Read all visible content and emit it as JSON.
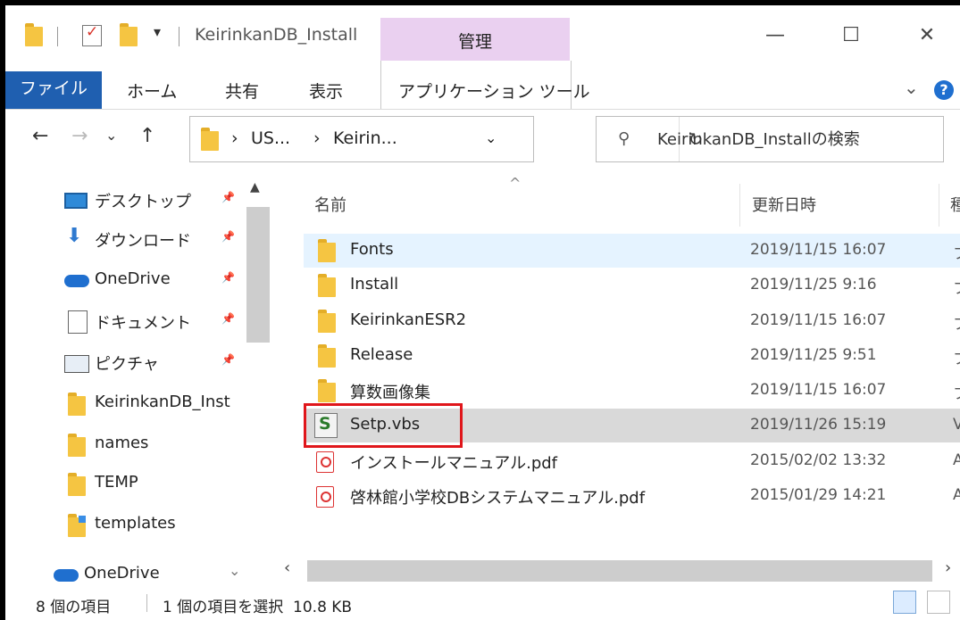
{
  "titlebar": {
    "title": "KeirinkanDB_Install",
    "context_tab": "管理",
    "minimize": "—",
    "maximize": "☐",
    "close": "✕",
    "qat_dropdown": "▾"
  },
  "ribbon": {
    "tabs": [
      "ファイル",
      "ホーム",
      "共有",
      "表示",
      "アプリケーション ツール"
    ],
    "expand": "⌄",
    "help": "?"
  },
  "address": {
    "crumbs": [
      "US...",
      "Keirin..."
    ],
    "chevron": "›",
    "dropdown": "⌄",
    "refresh": "↻",
    "nav_back": "←",
    "nav_forward": "→",
    "nav_recent": "⌄",
    "nav_up": "↑"
  },
  "search": {
    "placeholder": "KeirinkanDB_Installの検索"
  },
  "navpane": {
    "items": [
      {
        "label": "デスクトップ",
        "icon": "desktop-icon",
        "pinned": true
      },
      {
        "label": "ダウンロード",
        "icon": "download-icon",
        "pinned": true
      },
      {
        "label": "OneDrive",
        "icon": "cloud-icon",
        "pinned": true
      },
      {
        "label": "ドキュメント",
        "icon": "documents-icon",
        "pinned": true
      },
      {
        "label": "ピクチャ",
        "icon": "pictures-icon",
        "pinned": true
      },
      {
        "label": "KeirinkanDB_Inst",
        "icon": "folder-icon",
        "pinned": false
      },
      {
        "label": "names",
        "icon": "folder-icon",
        "pinned": false
      },
      {
        "label": "TEMP",
        "icon": "folder-icon",
        "pinned": false
      },
      {
        "label": "templates",
        "icon": "folder-shortcut-icon",
        "pinned": false
      },
      {
        "label": "OneDrive",
        "icon": "cloud-icon",
        "pinned": false
      }
    ],
    "pin_glyph": "📌",
    "collapse": "⌄"
  },
  "columns": {
    "name": "名前",
    "modified": "更新日時",
    "type": "種",
    "sort_caret": "^"
  },
  "files": [
    {
      "name": "Fonts",
      "date": "2019/11/15 16:07",
      "type": "フ",
      "icon": "folder-icon"
    },
    {
      "name": "Install",
      "date": "2019/11/25 9:16",
      "type": "フ",
      "icon": "folder-icon"
    },
    {
      "name": "KeirinkanESR2",
      "date": "2019/11/15 16:07",
      "type": "フ",
      "icon": "folder-icon"
    },
    {
      "name": "Release",
      "date": "2019/11/25 9:51",
      "type": "フ",
      "icon": "folder-icon"
    },
    {
      "name": "算数画像集",
      "date": "2019/11/15 16:07",
      "type": "フ",
      "icon": "folder-icon"
    },
    {
      "name": "Setp.vbs",
      "date": "2019/11/26 15:19",
      "type": "V",
      "icon": "vbs-script-icon"
    },
    {
      "name": "インストールマニュアル.pdf",
      "date": "2015/02/02 13:32",
      "type": "A",
      "icon": "pdf-icon"
    },
    {
      "name": "啓林館小学校DBシステムマニュアル.pdf",
      "date": "2015/01/29 14:21",
      "type": "A",
      "icon": "pdf-icon"
    }
  ],
  "status": {
    "count": "8 個の項目",
    "selection": "1 個の項目を選択  10.8 KB"
  }
}
